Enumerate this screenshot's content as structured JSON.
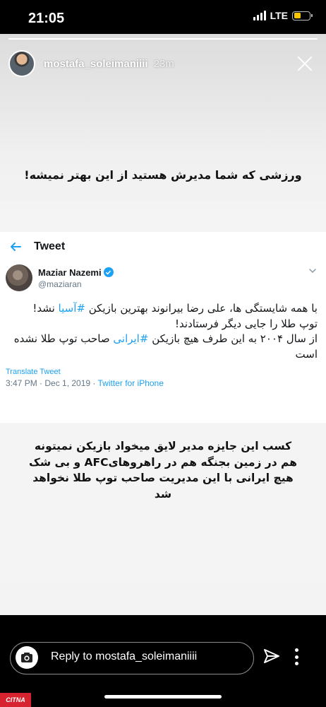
{
  "status_bar": {
    "time": "21:05",
    "network": "LTE",
    "battery_level": 0.45,
    "battery_color": "#f7c600"
  },
  "story": {
    "username": "mostafa_soleimaniiii",
    "time_ago": "23m",
    "close_icon": "close-icon",
    "caption_top": "ورزشی که شما مدیرش هستید از این بهتر نمیشه!",
    "caption_bottom": "کسب این جایزه مدیر لایق میخواد بازیکن نمیتونه هم در زمین بجنگه هم در راهروهایAFC و بی شک هیچ ایرانی با این مدیریت صاحب توپ طلا نخواهد شد"
  },
  "tweet": {
    "nav_title": "Tweet",
    "author_name": "Maziar Nazemi",
    "author_handle": "@maziaran",
    "body_line1_prefix": "با همه شایستگی ها، علی رضا بیرانوند بهترین بازیکن ",
    "body_hashtag1": "#آسیا",
    "body_line1_suffix": " نشد!",
    "body_line2": "توپ طلا را جایی دیگر  فرستادند!",
    "body_line3_prefix": "از سال ۲۰۰۴ به این طرف هیچ بازیکن ",
    "body_hashtag2": "#ایرانی",
    "body_line3_suffix": " صاحب توپ طلا نشده است",
    "translate_label": "Translate Tweet",
    "timestamp": "3:47 PM · Dec 1, 2019 · ",
    "source": "Twitter for iPhone",
    "link_color": "#1da1f2"
  },
  "reply": {
    "placeholder": "Reply to mostafa_soleimaniiii"
  },
  "watermark": {
    "text": "CITNA"
  }
}
